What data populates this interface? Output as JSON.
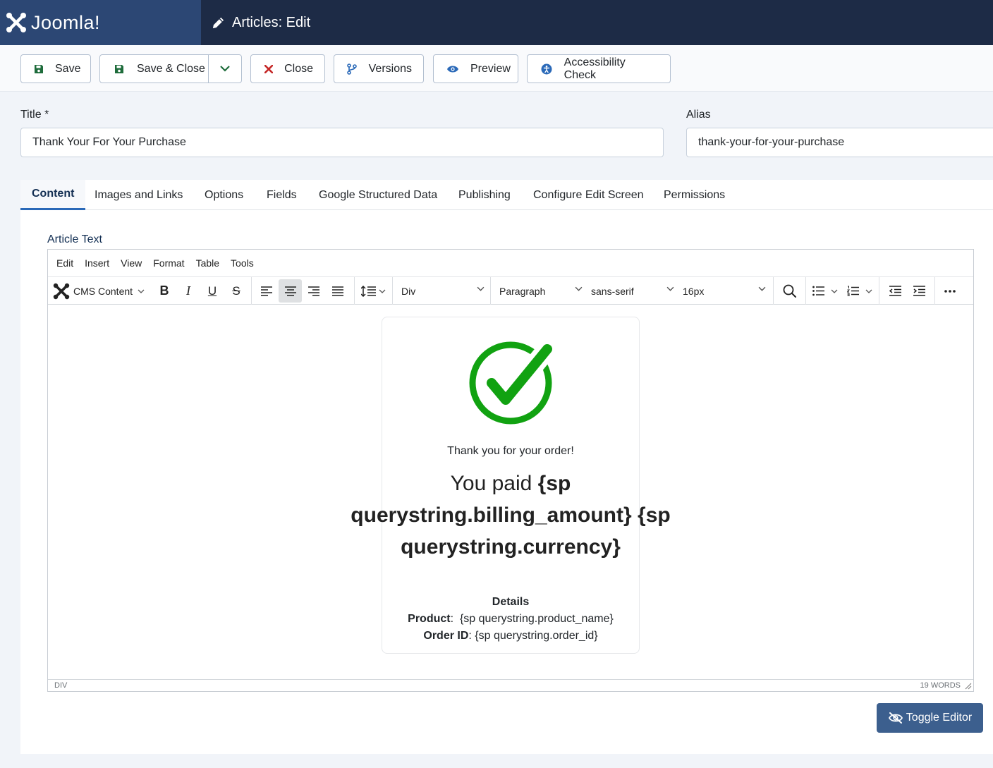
{
  "header": {
    "brand": "Joomla!",
    "page_title": "Articles: Edit"
  },
  "toolbar": {
    "save": "Save",
    "save_close": "Save & Close",
    "close": "Close",
    "versions": "Versions",
    "preview": "Preview",
    "accessibility": "Accessibility Check"
  },
  "form": {
    "title_label": "Title *",
    "title_value": "Thank Your For Your Purchase",
    "alias_label": "Alias",
    "alias_value": "thank-your-for-your-purchase"
  },
  "tabs": [
    {
      "label": "Content",
      "active": true
    },
    {
      "label": "Images and Links"
    },
    {
      "label": "Options"
    },
    {
      "label": "Fields"
    },
    {
      "label": "Google Structured Data"
    },
    {
      "label": "Publishing"
    },
    {
      "label": "Configure Edit Screen"
    },
    {
      "label": "Permissions"
    }
  ],
  "editor": {
    "label": "Article Text",
    "menu": [
      "Edit",
      "Insert",
      "View",
      "Format",
      "Table",
      "Tools"
    ],
    "cms_content": "CMS Content",
    "block_select": "Div",
    "format_select": "Paragraph",
    "font_select": "sans-serif",
    "size_select": "16px",
    "status_path": "DIV",
    "word_count": "19 WORDS",
    "toggle_label": "Toggle Editor"
  },
  "article": {
    "thanks": "Thank you for your order!",
    "paid_prefix": "You paid ",
    "paid_amount": "{sp querystring.billing_amount}",
    "paid_currency": "{sp querystring.currency}",
    "details_heading": "Details",
    "product_label": "Product",
    "product_value": "{sp querystring.product_name}",
    "order_label": "Order ID",
    "order_value": "{sp querystring.order_id}"
  },
  "colors": {
    "header_bg": "#1d2b46",
    "brand_bg": "#2c4774",
    "tab_accent": "#2a69b8",
    "check_green": "#11a211",
    "toggle_bg": "#3c5f8e"
  }
}
